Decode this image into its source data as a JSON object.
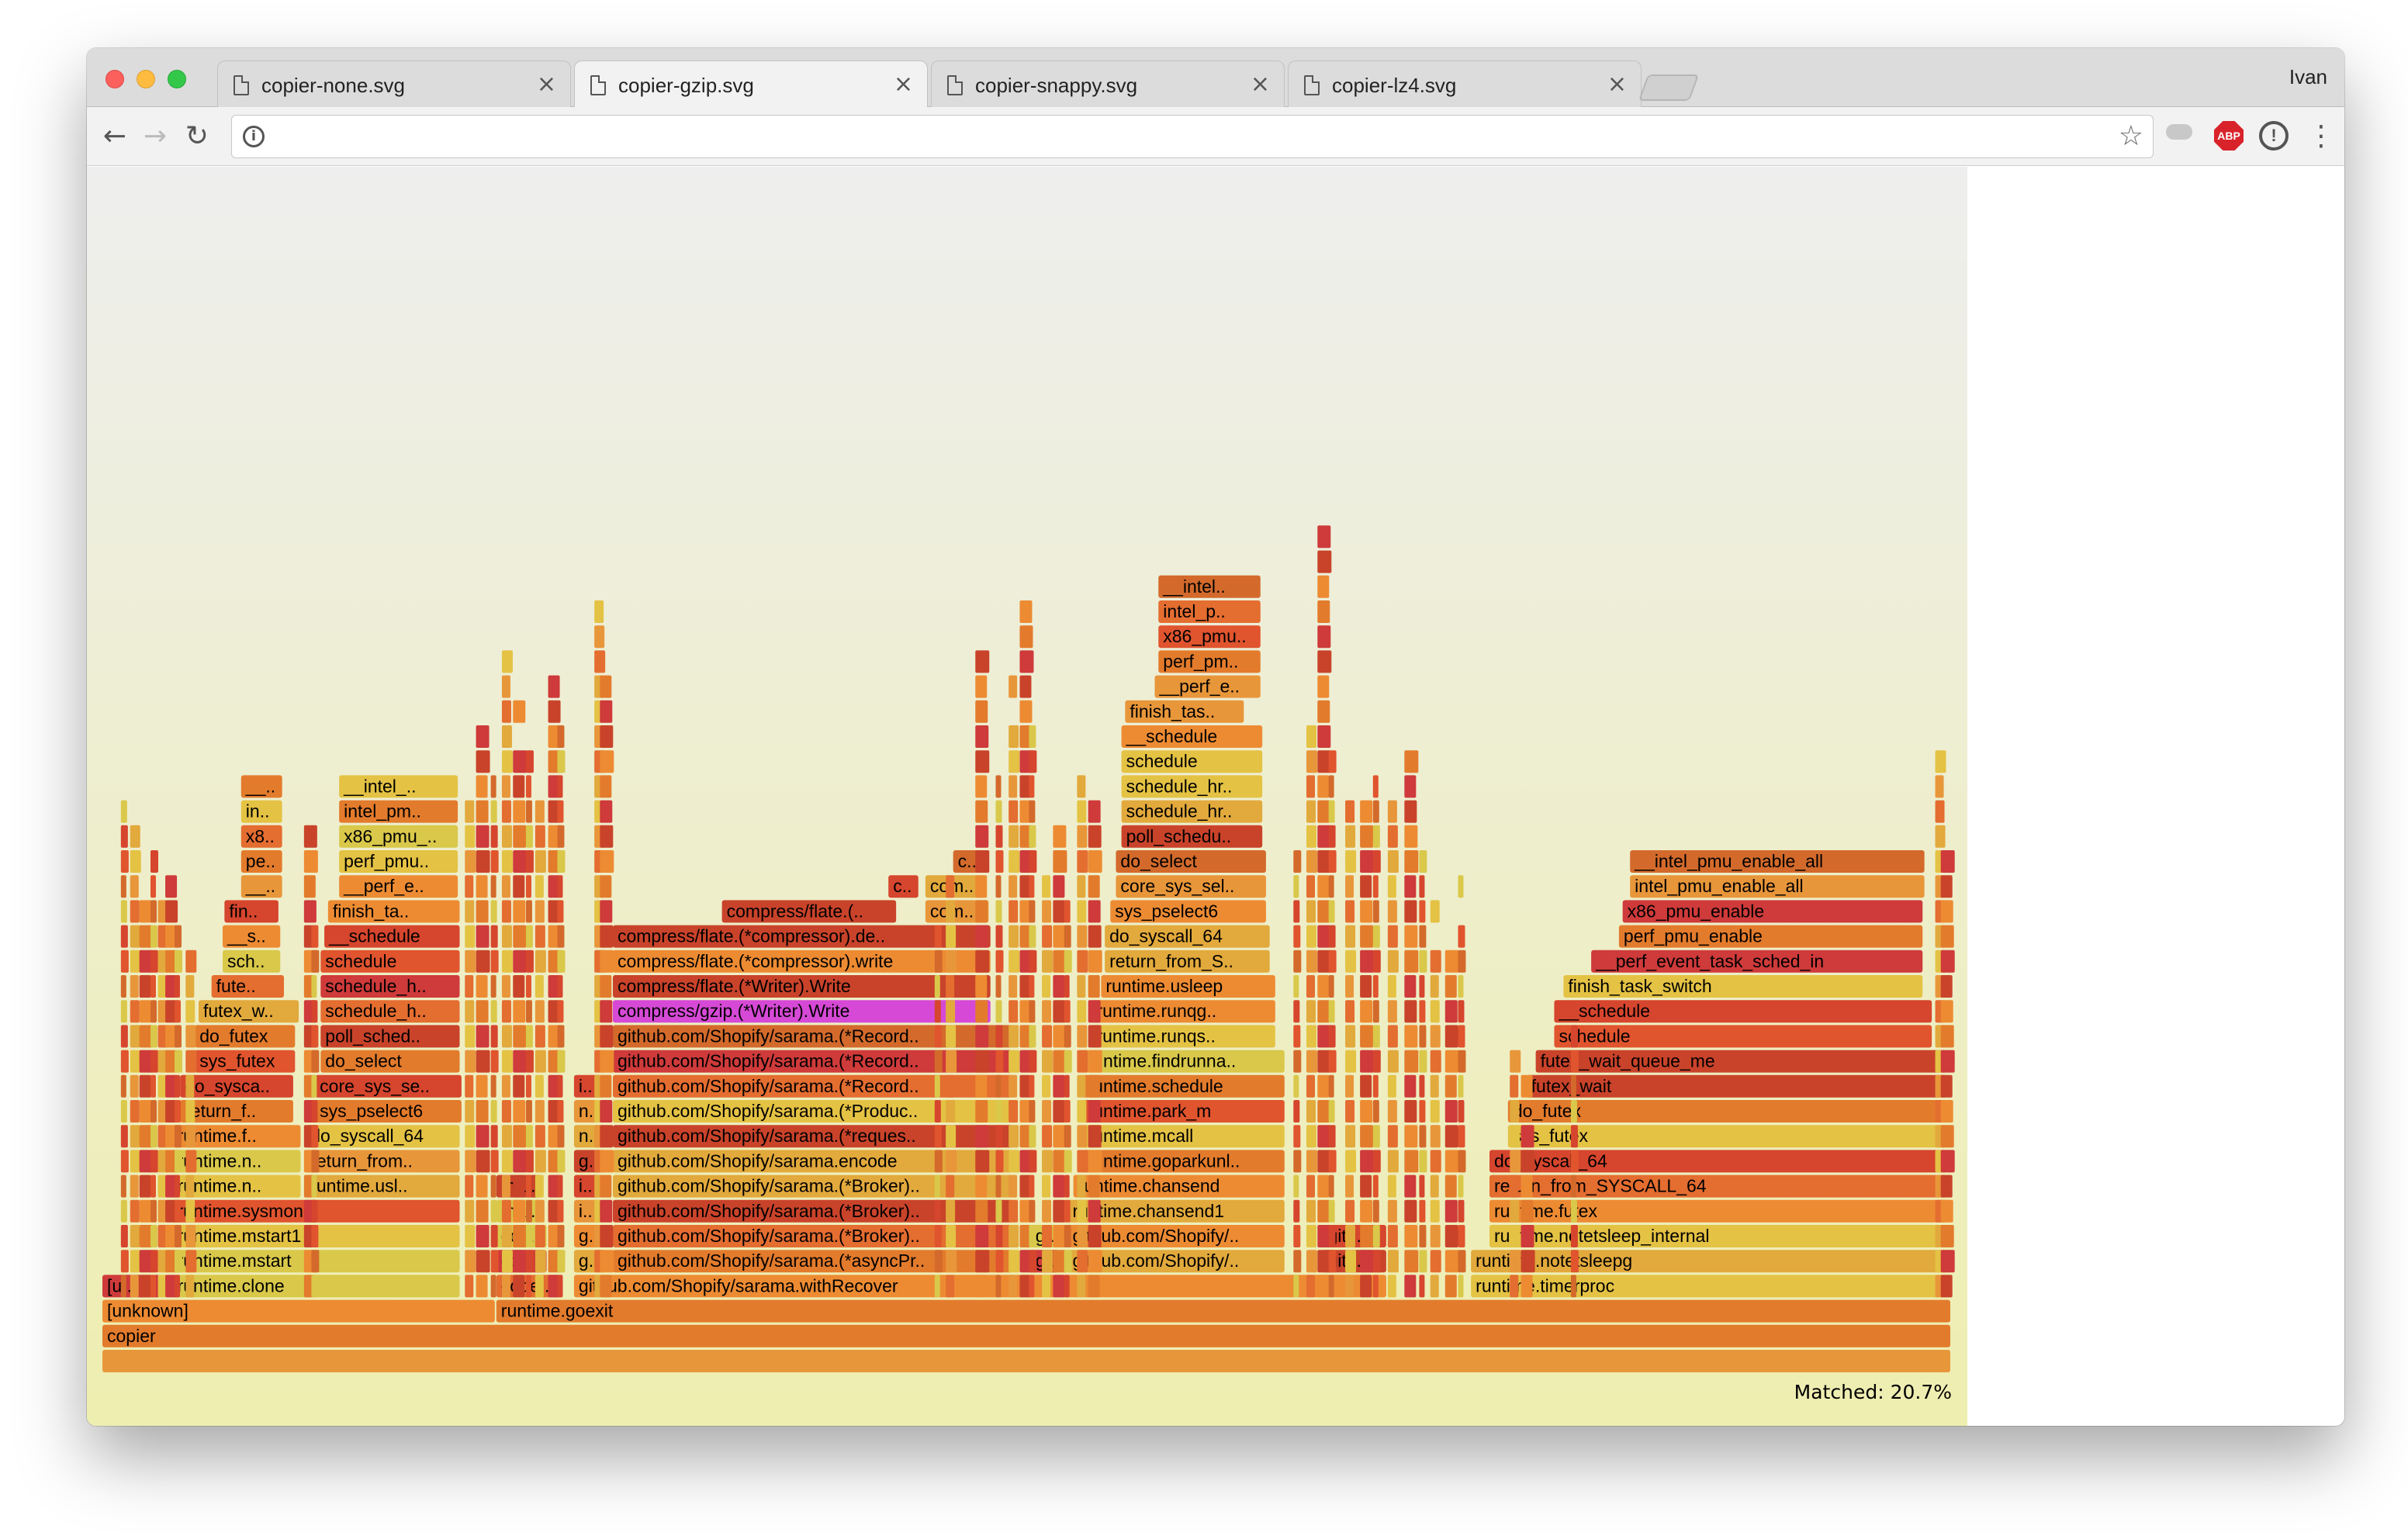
{
  "browser": {
    "tabs": [
      {
        "title": "copier-none.svg",
        "close": "×"
      },
      {
        "title": "copier-gzip.svg",
        "close": "×"
      },
      {
        "title": "copier-snappy.svg",
        "close": "×"
      },
      {
        "title": "copier-lz4.svg",
        "close": "×"
      }
    ],
    "active_tab": 1,
    "profile_name": "Ivan",
    "address_value": "",
    "extensions": {
      "adblock_label": "ABP",
      "info_label": "!"
    },
    "icons": {
      "back": "←",
      "forward": "→",
      "reload": "↻",
      "star": "☆",
      "menu": "⋮",
      "site_info": "i"
    }
  },
  "flamegraph": {
    "matched_text": "Matched: 20.7%",
    "palette": [
      "#e0542e",
      "#e37b2c",
      "#e8963a",
      "#d6452d",
      "#ed8b33",
      "#e4c244",
      "#d9c84a",
      "#c9432a",
      "#e2a93c",
      "#d36a2b",
      "#cf3a3a",
      "#e46d30"
    ],
    "highlight_color": "#d649d6",
    "frames": [
      {
        "label": "",
        "s": 0,
        "d": 100,
        "depth": 0
      },
      {
        "label": "copier",
        "s": 0,
        "d": 100,
        "depth": 1
      },
      {
        "label": "[unknown]",
        "s": 0,
        "d": 21.3,
        "depth": 2
      },
      {
        "label": "runtime.goexit",
        "s": 21.3,
        "d": 78.7,
        "depth": 2
      },
      {
        "label": "[u..",
        "s": 0,
        "d": 3.2,
        "depth": 3
      },
      {
        "label": "runtime.clone",
        "s": 3.8,
        "d": 15.6,
        "depth": 3
      },
      {
        "label": "code..",
        "s": 21.3,
        "d": 3.5,
        "depth": 3
      },
      {
        "label": "github.com/Shopify/sarama.withRecover",
        "s": 25.5,
        "d": 44.0,
        "depth": 3
      },
      {
        "label": "runtime.timerproc",
        "s": 74.0,
        "d": 26.0,
        "depth": 3
      },
      {
        "label": "runtime.mstart",
        "s": 3.8,
        "d": 15.6,
        "depth": 4
      },
      {
        "label": "cod..",
        "s": 21.3,
        "d": 2.8,
        "depth": 4
      },
      {
        "label": "g..",
        "s": 25.5,
        "d": 1.6,
        "depth": 4
      },
      {
        "label": "github.com/Shopify/sarama.(*asyncPr..",
        "s": 27.6,
        "d": 21.7,
        "depth": 4
      },
      {
        "label": "g..",
        "s": 50.2,
        "d": 1.6,
        "depth": 4
      },
      {
        "label": "github.com/Shopify/..",
        "s": 52.2,
        "d": 11.8,
        "depth": 4
      },
      {
        "label": "gith..",
        "s": 66.0,
        "d": 3.5,
        "depth": 4
      },
      {
        "label": "runtime.notetsleepg",
        "s": 74.0,
        "d": 26.0,
        "depth": 4
      },
      {
        "label": "runtime.mstart1",
        "s": 3.8,
        "d": 15.6,
        "depth": 5
      },
      {
        "label": "cod..",
        "s": 21.3,
        "d": 2.8,
        "depth": 5
      },
      {
        "label": "g..",
        "s": 25.5,
        "d": 1.6,
        "depth": 5
      },
      {
        "label": "github.com/Shopify/sarama.(*Broker)..",
        "s": 27.6,
        "d": 21.7,
        "depth": 5
      },
      {
        "label": "g..",
        "s": 50.2,
        "d": 1.6,
        "depth": 5
      },
      {
        "label": "github.com/Shopify/..",
        "s": 52.2,
        "d": 11.8,
        "depth": 5
      },
      {
        "label": "gith..",
        "s": 66.0,
        "d": 3.5,
        "depth": 5
      },
      {
        "label": "runtime.notetsleep_internal",
        "s": 75.0,
        "d": 25.0,
        "depth": 5
      },
      {
        "label": "runtime.sysmon",
        "s": 3.8,
        "d": 15.6,
        "depth": 6
      },
      {
        "label": "ma..",
        "s": 21.3,
        "d": 2.5,
        "depth": 6
      },
      {
        "label": "i..",
        "s": 25.5,
        "d": 1.6,
        "depth": 6
      },
      {
        "label": "github.com/Shopify/sarama.(*Broker)..",
        "s": 27.6,
        "d": 21.7,
        "depth": 6
      },
      {
        "label": "runtime.chansend1",
        "s": 52.2,
        "d": 11.8,
        "depth": 6
      },
      {
        "label": "runtime.futex",
        "s": 75.0,
        "d": 25.0,
        "depth": 6
      },
      {
        "label": "runtime.n..",
        "s": 3.8,
        "d": 7.0,
        "depth": 7
      },
      {
        "label": "runtime.usl..",
        "s": 11.0,
        "d": 8.4,
        "depth": 7
      },
      {
        "label": "ma..",
        "s": 21.3,
        "d": 2.5,
        "depth": 7
      },
      {
        "label": "i..",
        "s": 25.5,
        "d": 1.6,
        "depth": 7
      },
      {
        "label": "github.com/Shopify/sarama.(*Broker)..",
        "s": 27.6,
        "d": 21.7,
        "depth": 7
      },
      {
        "label": "runtime.chansend",
        "s": 52.5,
        "d": 11.5,
        "depth": 7
      },
      {
        "label": "return_from_SYSCALL_64",
        "s": 75.0,
        "d": 24.8,
        "depth": 7
      },
      {
        "label": "runtime.n..",
        "s": 3.8,
        "d": 7.0,
        "depth": 8
      },
      {
        "label": "return_from..",
        "s": 11.0,
        "d": 8.4,
        "depth": 8
      },
      {
        "label": "g..",
        "s": 25.5,
        "d": 1.6,
        "depth": 8
      },
      {
        "label": "github.com/Shopify/sarama.encode",
        "s": 27.6,
        "d": 21.7,
        "depth": 8
      },
      {
        "label": "runtime.goparkunl..",
        "s": 53.0,
        "d": 11.0,
        "depth": 8
      },
      {
        "label": "do_syscall_64",
        "s": 75.0,
        "d": 24.8,
        "depth": 8
      },
      {
        "label": "runtime.f..",
        "s": 3.8,
        "d": 7.0,
        "depth": 9
      },
      {
        "label": "do_syscall_64",
        "s": 11.0,
        "d": 8.4,
        "depth": 9
      },
      {
        "label": "n..",
        "s": 25.5,
        "d": 1.6,
        "depth": 9
      },
      {
        "label": "github.com/Shopify/sarama.(*reques..",
        "s": 27.6,
        "d": 21.7,
        "depth": 9
      },
      {
        "label": "runtime.mcall",
        "s": 53.0,
        "d": 11.0,
        "depth": 9
      },
      {
        "label": "sys_futex",
        "s": 76.0,
        "d": 23.8,
        "depth": 9
      },
      {
        "label": "return_f..",
        "s": 4.2,
        "d": 6.2,
        "depth": 10
      },
      {
        "label": "sys_pselect6",
        "s": 11.5,
        "d": 8.0,
        "depth": 10
      },
      {
        "label": "n..",
        "s": 25.5,
        "d": 1.6,
        "depth": 10
      },
      {
        "label": "github.com/Shopify/sarama.(*Produc..",
        "s": 27.6,
        "d": 21.7,
        "depth": 10
      },
      {
        "label": "runtime.park_m",
        "s": 53.0,
        "d": 11.0,
        "depth": 10
      },
      {
        "label": "do_futex",
        "s": 76.0,
        "d": 23.8,
        "depth": 10
      },
      {
        "label": "do_sysca..",
        "s": 4.2,
        "d": 6.2,
        "depth": 11
      },
      {
        "label": "core_sys_se..",
        "s": 11.5,
        "d": 8.0,
        "depth": 11
      },
      {
        "label": "i..",
        "s": 25.5,
        "d": 1.6,
        "depth": 11
      },
      {
        "label": "github.com/Shopify/sarama.(*Record..",
        "s": 27.6,
        "d": 21.7,
        "depth": 11
      },
      {
        "label": "runtime.schedule",
        "s": 53.0,
        "d": 11.0,
        "depth": 11
      },
      {
        "label": "futex_wait",
        "s": 77.0,
        "d": 22.8,
        "depth": 11
      },
      {
        "label": "sys_futex",
        "s": 5.0,
        "d": 5.5,
        "depth": 12
      },
      {
        "label": "do_select",
        "s": 11.8,
        "d": 7.6,
        "depth": 12
      },
      {
        "label": "github.com/Shopify/sarama.(*Record..",
        "s": 27.6,
        "d": 21.7,
        "depth": 12
      },
      {
        "label": "runtime.findrunna..",
        "s": 53.0,
        "d": 11.0,
        "depth": 12
      },
      {
        "label": "futex_wait_queue_me",
        "s": 77.5,
        "d": 22.3,
        "depth": 12
      },
      {
        "label": "do_futex",
        "s": 5.0,
        "d": 5.5,
        "depth": 13
      },
      {
        "label": "poll_sched..",
        "s": 11.8,
        "d": 7.6,
        "depth": 13
      },
      {
        "label": "github.com/Shopify/sarama.(*Record..",
        "s": 27.6,
        "d": 21.7,
        "depth": 13
      },
      {
        "label": "runtime.runqs..",
        "s": 53.5,
        "d": 10.0,
        "depth": 13
      },
      {
        "label": "schedule",
        "s": 78.5,
        "d": 20.5,
        "depth": 13
      },
      {
        "label": "futex_w..",
        "s": 5.2,
        "d": 5.5,
        "depth": 14
      },
      {
        "label": "schedule_h..",
        "s": 11.8,
        "d": 7.6,
        "depth": 14
      },
      {
        "label": "compress/gzip.(*Writer).Write",
        "s": 27.6,
        "d": 20.5,
        "depth": 14,
        "highlight": true
      },
      {
        "label": "runtime.runqg..",
        "s": 53.5,
        "d": 10.0,
        "depth": 14
      },
      {
        "label": "__schedule",
        "s": 78.5,
        "d": 20.5,
        "depth": 14
      },
      {
        "label": "fute..",
        "s": 5.9,
        "d": 4.0,
        "depth": 15
      },
      {
        "label": "schedule_h..",
        "s": 11.8,
        "d": 7.6,
        "depth": 15
      },
      {
        "label": "compress/flate.(*Writer).Write",
        "s": 27.6,
        "d": 20.5,
        "depth": 15
      },
      {
        "label": "runtime.usleep",
        "s": 54.0,
        "d": 9.5,
        "depth": 15
      },
      {
        "label": "finish_task_switch",
        "s": 79.0,
        "d": 19.5,
        "depth": 15
      },
      {
        "label": "sch..",
        "s": 6.5,
        "d": 3.2,
        "depth": 16
      },
      {
        "label": "schedule",
        "s": 11.8,
        "d": 7.6,
        "depth": 16
      },
      {
        "label": "compress/flate.(*compressor).write",
        "s": 27.6,
        "d": 20.5,
        "depth": 16
      },
      {
        "label": "return_from_S..",
        "s": 54.2,
        "d": 9.0,
        "depth": 16
      },
      {
        "label": "__perf_event_task_sched_in",
        "s": 80.5,
        "d": 18.0,
        "depth": 16
      },
      {
        "label": "__s..",
        "s": 6.5,
        "d": 3.2,
        "depth": 17
      },
      {
        "label": "__schedule",
        "s": 12.0,
        "d": 7.4,
        "depth": 17
      },
      {
        "label": "compress/flate.(*compressor).de..",
        "s": 27.6,
        "d": 20.5,
        "depth": 17
      },
      {
        "label": "do_syscall_64",
        "s": 54.2,
        "d": 9.0,
        "depth": 17
      },
      {
        "label": "perf_pmu_enable",
        "s": 82.0,
        "d": 16.5,
        "depth": 17
      },
      {
        "label": "fin..",
        "s": 6.6,
        "d": 3.0,
        "depth": 18
      },
      {
        "label": "finish_ta..",
        "s": 12.2,
        "d": 7.2,
        "depth": 18
      },
      {
        "label": "compress/flate.(..",
        "s": 33.5,
        "d": 9.5,
        "depth": 18
      },
      {
        "label": "com..",
        "s": 44.5,
        "d": 3.5,
        "depth": 18
      },
      {
        "label": "sys_pselect6",
        "s": 54.5,
        "d": 8.5,
        "depth": 18
      },
      {
        "label": "x86_pmu_enable",
        "s": 82.2,
        "d": 16.3,
        "depth": 18
      },
      {
        "label": "__..",
        "s": 7.5,
        "d": 2.3,
        "depth": 19
      },
      {
        "label": "__perf_e..",
        "s": 12.8,
        "d": 6.5,
        "depth": 19
      },
      {
        "label": "c..",
        "s": 42.5,
        "d": 1.7,
        "depth": 19
      },
      {
        "label": "com..",
        "s": 44.5,
        "d": 3.3,
        "depth": 19
      },
      {
        "label": "core_sys_sel..",
        "s": 54.8,
        "d": 8.2,
        "depth": 19
      },
      {
        "label": "intel_pmu_enable_all",
        "s": 82.6,
        "d": 16.0,
        "depth": 19
      },
      {
        "label": "pe..",
        "s": 7.5,
        "d": 2.3,
        "depth": 20
      },
      {
        "label": "perf_pmu..",
        "s": 12.8,
        "d": 6.5,
        "depth": 20
      },
      {
        "label": "c..",
        "s": 46.0,
        "d": 1.8,
        "depth": 20
      },
      {
        "label": "do_select",
        "s": 54.8,
        "d": 8.2,
        "depth": 20
      },
      {
        "label": "__intel_pmu_enable_all",
        "s": 82.6,
        "d": 16.0,
        "depth": 20
      },
      {
        "label": "x8..",
        "s": 7.5,
        "d": 2.3,
        "depth": 21
      },
      {
        "label": "x86_pmu_..",
        "s": 12.8,
        "d": 6.5,
        "depth": 21
      },
      {
        "label": "poll_schedu..",
        "s": 55.1,
        "d": 7.7,
        "depth": 21
      },
      {
        "label": "in..",
        "s": 7.5,
        "d": 2.3,
        "depth": 22
      },
      {
        "label": "intel_pm..",
        "s": 12.8,
        "d": 6.5,
        "depth": 22
      },
      {
        "label": "schedule_hr..",
        "s": 55.1,
        "d": 7.7,
        "depth": 22
      },
      {
        "label": "__..",
        "s": 7.5,
        "d": 2.3,
        "depth": 23
      },
      {
        "label": "__intel_..",
        "s": 12.8,
        "d": 6.5,
        "depth": 23
      },
      {
        "label": "schedule_hr..",
        "s": 55.1,
        "d": 7.7,
        "depth": 23
      },
      {
        "label": "schedule",
        "s": 55.1,
        "d": 7.7,
        "depth": 24
      },
      {
        "label": "__schedule",
        "s": 55.1,
        "d": 7.7,
        "depth": 25
      },
      {
        "label": "finish_tas..",
        "s": 55.3,
        "d": 6.5,
        "depth": 26
      },
      {
        "label": "__perf_e..",
        "s": 56.9,
        "d": 5.8,
        "depth": 27
      },
      {
        "label": "perf_pm..",
        "s": 57.1,
        "d": 5.6,
        "depth": 28
      },
      {
        "label": "x86_pmu..",
        "s": 57.1,
        "d": 5.6,
        "depth": 29
      },
      {
        "label": "intel_p..",
        "s": 57.1,
        "d": 5.6,
        "depth": 30
      },
      {
        "label": "__intel..",
        "s": 57.1,
        "d": 5.6,
        "depth": 31
      }
    ]
  }
}
